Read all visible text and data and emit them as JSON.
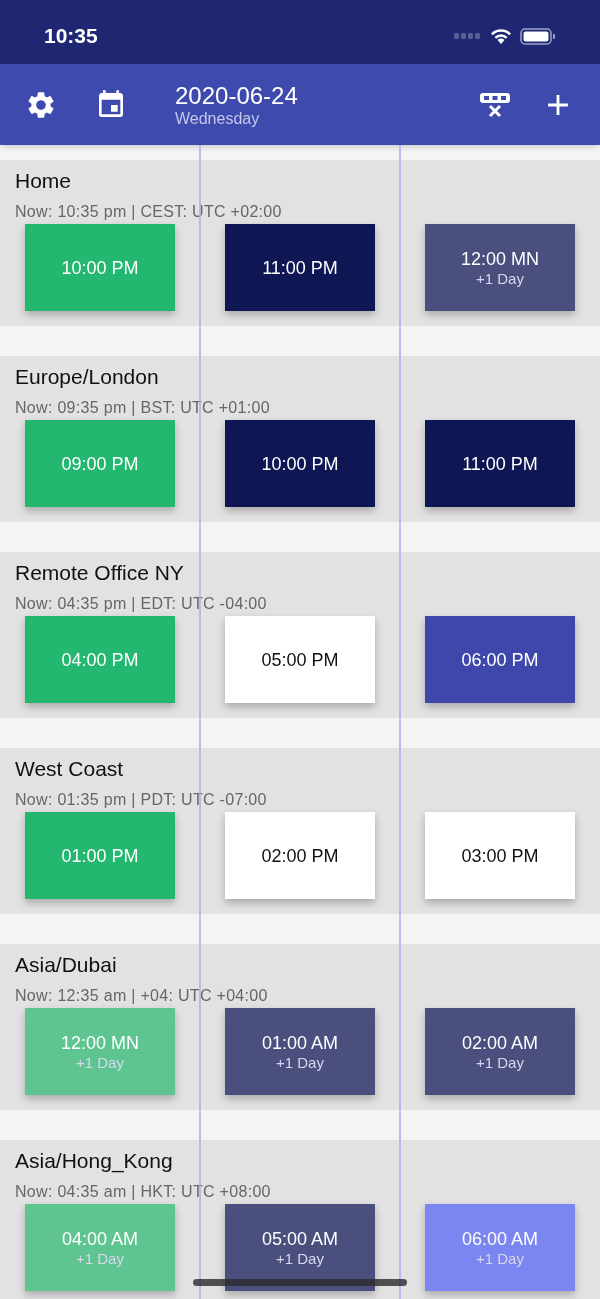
{
  "status_bar": {
    "time": "10:35"
  },
  "header": {
    "date": "2020-06-24",
    "weekday": "Wednesday"
  },
  "zones": [
    {
      "name": "Home",
      "info": "Now: 10:35 pm | CEST: UTC +02:00",
      "slots": [
        {
          "time": "10:00 PM",
          "color": "#23b76f"
        },
        {
          "time": "11:00 PM",
          "color": "#0f1654"
        },
        {
          "time": "12:00 MN",
          "note": "+1 Day",
          "color": "#4b4f7e"
        }
      ]
    },
    {
      "name": "Europe/London",
      "info": "Now: 09:35 pm | BST: UTC +01:00",
      "slots": [
        {
          "time": "09:00 PM",
          "color": "#23b76f"
        },
        {
          "time": "10:00 PM",
          "color": "#0f1654"
        },
        {
          "time": "11:00 PM",
          "color": "#0f1654"
        }
      ]
    },
    {
      "name": "Remote Office NY",
      "info": "Now: 04:35 pm | EDT: UTC -04:00",
      "slots": [
        {
          "time": "04:00 PM",
          "color": "#23b76f"
        },
        {
          "time": "05:00 PM",
          "color": "#ffffff"
        },
        {
          "time": "06:00 PM",
          "color": "#3f48aa"
        }
      ]
    },
    {
      "name": "West Coast",
      "info": "Now: 01:35 pm | PDT: UTC -07:00",
      "slots": [
        {
          "time": "01:00 PM",
          "color": "#23b76f"
        },
        {
          "time": "02:00 PM",
          "color": "#ffffff"
        },
        {
          "time": "03:00 PM",
          "color": "#ffffff"
        }
      ]
    },
    {
      "name": "Asia/Dubai",
      "info": "Now: 12:35 am | +04: UTC +04:00",
      "slots": [
        {
          "time": "12:00 MN",
          "note": "+1 Day",
          "color": "#5ec590"
        },
        {
          "time": "01:00 AM",
          "note": "+1 Day",
          "color": "#4b4f7e"
        },
        {
          "time": "02:00 AM",
          "note": "+1 Day",
          "color": "#4b4f7e"
        }
      ]
    },
    {
      "name": "Asia/Hong_Kong",
      "info": "Now: 04:35 am | HKT: UTC +08:00",
      "slots": [
        {
          "time": "04:00 AM",
          "note": "+1 Day",
          "color": "#5ec590"
        },
        {
          "time": "05:00 AM",
          "note": "+1 Day",
          "color": "#4b4f7e"
        },
        {
          "time": "06:00 AM",
          "note": "+1 Day",
          "color": "#7c86f0"
        }
      ]
    }
  ]
}
